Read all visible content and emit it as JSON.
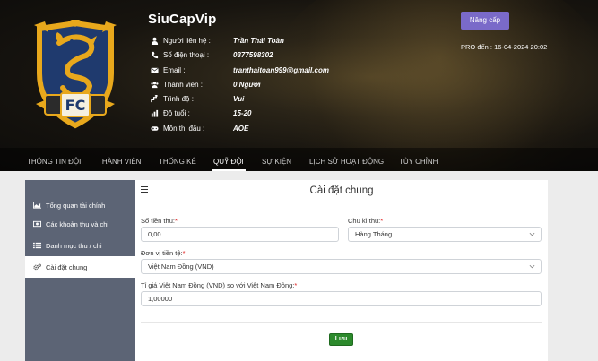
{
  "team": {
    "name": "SiuCapVip"
  },
  "info": [
    {
      "icon": "user-icon",
      "label": "Người liên hệ :",
      "value": "Trần Thái Toàn"
    },
    {
      "icon": "phone-icon",
      "label": "Số điện thoại :",
      "value": "0377598302"
    },
    {
      "icon": "envelope-icon",
      "label": "Email :",
      "value": "tranthaitoan999@gmail.com"
    },
    {
      "icon": "users-icon",
      "label": "Thành viên :",
      "value": "0 Người"
    },
    {
      "icon": "level-icon",
      "label": "Trình độ :",
      "value": "Vui"
    },
    {
      "icon": "age-icon",
      "label": "Độ tuổi :",
      "value": "15-20"
    },
    {
      "icon": "gamepad-icon",
      "label": "Môn thi đấu :",
      "value": "AOE"
    }
  ],
  "upgrade": {
    "label": "Nâng cấp"
  },
  "pro": {
    "text": "PRO đến : 16-04-2024 20:02"
  },
  "tabs": [
    {
      "label": "Thông tin đội"
    },
    {
      "label": "Thành viên"
    },
    {
      "label": "Thống kê"
    },
    {
      "label": "Quỹ đội"
    },
    {
      "label": "Sự kiện"
    },
    {
      "label": "Lịch sử hoạt động"
    },
    {
      "label": "Tùy chỉnh"
    }
  ],
  "active_tab": "Quỹ đội",
  "sidebar": [
    {
      "icon": "chart-area-icon",
      "label": "Tổng quan tài chính"
    },
    {
      "icon": "money-icon",
      "label": "Các khoản thu và chi"
    },
    {
      "icon": "list-icon",
      "label": "Danh mục thu / chi"
    },
    {
      "icon": "cogs-icon",
      "label": "Cài đặt chung"
    }
  ],
  "active_sidebar": "Cài đặt chung",
  "card": {
    "title": "Cài đặt chung"
  },
  "form": {
    "amount": {
      "label": "Số tiền thu:",
      "required": "*",
      "value": "0,00"
    },
    "cycle": {
      "label": "Chu kì thu:",
      "required": "*",
      "value": "Hàng Tháng"
    },
    "currency": {
      "label": "Đơn vị tiền tệ:",
      "required": "*",
      "value": "Việt Nam Đồng (VND)"
    },
    "rate": {
      "label": "Tỉ giá Việt Nam Đồng (VND) so với Việt Nam Đồng:",
      "required": "*",
      "value": "1,00000"
    }
  },
  "save": {
    "label": "Lưu"
  },
  "colors": {
    "accent": "#7a6ac9",
    "save": "#2c8a2c",
    "sidebar": "#5c6475",
    "required": "#e02020",
    "logo_gold": "#e8a81c",
    "logo_blue": "#1f3a6e"
  }
}
